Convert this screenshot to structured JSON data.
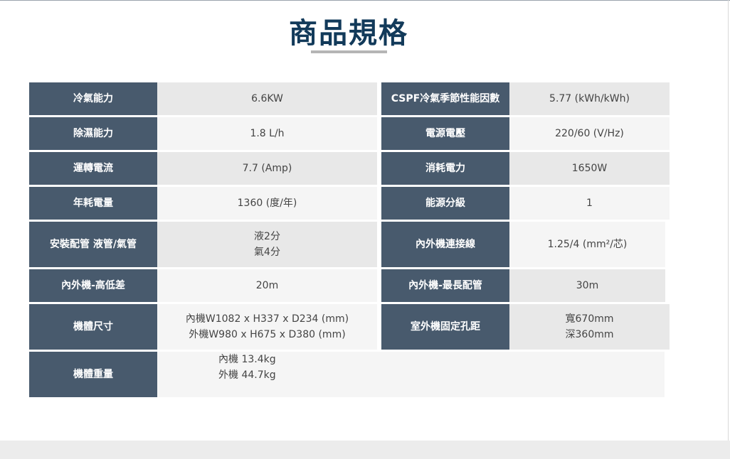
{
  "title": "商品規格",
  "rows": [
    {
      "l1": "冷氣能力",
      "v1": "6.6KW",
      "l2": "CSPF冷氣季節性能因數",
      "v2": "5.77 (kWh/kWh)"
    },
    {
      "l1": "除濕能力",
      "v1": "1.8 L/h",
      "l2": "電源電壓",
      "v2": "220/60 (V/Hz)"
    },
    {
      "l1": "運轉電流",
      "v1": "7.7 (Amp)",
      "l2": "消耗電力",
      "v2": "1650W"
    },
    {
      "l1": "年耗電量",
      "v1": "1360 (度/年)",
      "l2": "能源分級",
      "v2": "1"
    },
    {
      "l1": "安裝配管 液管/氣管",
      "v1a": "液2分",
      "v1b": "氣4分",
      "l2": "內外機連接線",
      "v2": "1.25/4 (mm²/芯)"
    },
    {
      "l1": "內外機-高低差",
      "v1": "20m",
      "l2": "內外機-最長配管",
      "v2": "30m"
    },
    {
      "l1": "機體尺寸",
      "v1a": "內機W1082 x H337 x D234 (mm)",
      "v1b": "外機W980 x H675 x D380 (mm)",
      "l2": "室外機固定孔距",
      "v2a": "寬670mm",
      "v2b": "深360mm"
    },
    {
      "l1": "機體重量",
      "v1a": "內機 13.4kg",
      "v1b": "外機 44.7kg"
    }
  ],
  "colors": {
    "title": "#123a5a",
    "label_bg": "#485a6d",
    "value_bg_dark": "#e8e8e8",
    "value_bg_light": "#f5f5f5"
  }
}
